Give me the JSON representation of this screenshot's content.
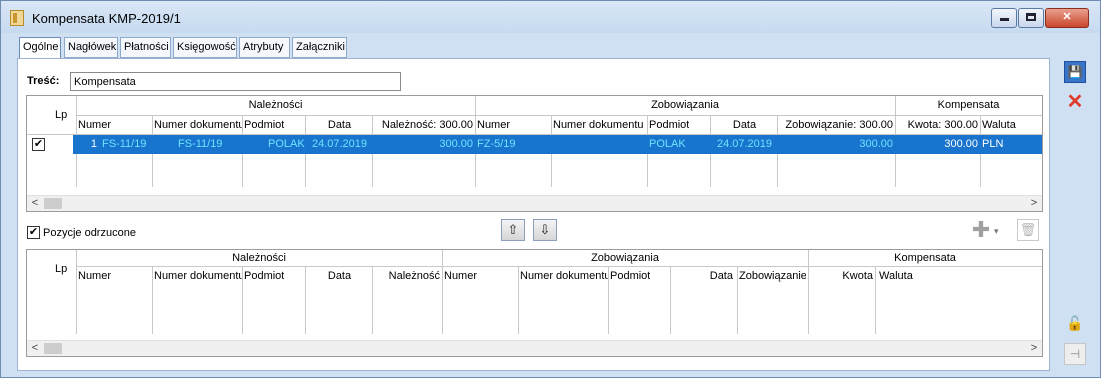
{
  "window": {
    "title": "Kompensata KMP-2019/1"
  },
  "tabs": [
    {
      "label": "Ogólne",
      "active": true
    },
    {
      "label": "Nagłówek"
    },
    {
      "label": "Płatności"
    },
    {
      "label": "Księgowość"
    },
    {
      "label": "Atrybuty"
    },
    {
      "label": "Załączniki"
    }
  ],
  "form": {
    "tresc_label": "Treść:",
    "tresc_value": "Kompensata"
  },
  "grid1": {
    "lp_header": "Lp",
    "groups": {
      "naleznosci": "Należności",
      "zobowiazania": "Zobowiązania",
      "kompensata": "Kompensata"
    },
    "columns": {
      "numer": "Numer",
      "numer_dokumentu": "Numer dokumentu",
      "podmiot": "Podmiot",
      "data": "Data",
      "naleznosc": "Należność: 300.00",
      "z_numer": "Numer",
      "z_numer_dokumentu": "Numer dokumentu",
      "z_podmiot": "Podmiot",
      "z_data": "Data",
      "zobowiazanie": "Zobowiązanie: 300.00",
      "kwota": "Kwota: 300.00",
      "waluta": "Waluta"
    },
    "rows": [
      {
        "checked": true,
        "lp": "1",
        "numer": "FS-11/19",
        "numer_dokumentu": "FS-11/19",
        "podmiot": "POLAK",
        "data": "24.07.2019",
        "naleznosc": "300.00",
        "z_numer": "FZ-5/19",
        "z_numer_dokumentu": "",
        "z_podmiot": "POLAK",
        "z_data": "24.07.2019",
        "zobowiazanie": "300.00",
        "kwota": "300.00",
        "waluta": "PLN"
      }
    ],
    "scroll_left": "<",
    "scroll_right": ">"
  },
  "rejected": {
    "checkbox_label": "Pozycje odrzucone",
    "checked": true
  },
  "grid2": {
    "lp_header": "Lp",
    "groups": {
      "naleznosci": "Należności",
      "zobowiazania": "Zobowiązania",
      "kompensata": "Kompensata"
    },
    "columns": {
      "numer": "Numer",
      "numer_dokumentu": "Numer dokumentu",
      "podmiot": "Podmiot",
      "data": "Data",
      "naleznosc": "Należność",
      "z_numer": "Numer",
      "z_numer_dokumentu": "Numer dokumentu",
      "z_podmiot": "Podmiot",
      "z_data": "Data",
      "zobowiazanie": "Zobowiązanie",
      "kwota": "Kwota",
      "waluta": "Waluta"
    },
    "scroll_left": "<",
    "scroll_right": ">"
  },
  "icons": {
    "move_up": "upload-tray-icon",
    "move_down": "download-tray-icon",
    "add": "plus-icon",
    "delete": "trash-icon",
    "save": "floppy-disk-icon",
    "cancel": "close-icon",
    "lock": "padlock-icon",
    "pin": "pin-icon"
  }
}
